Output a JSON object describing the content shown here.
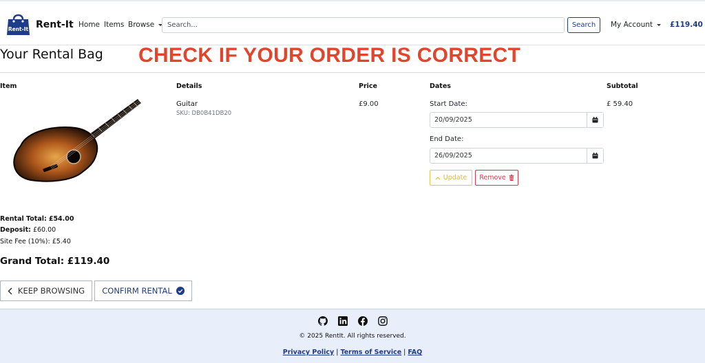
{
  "navbar": {
    "brand_name": "Rent-It",
    "logo_text": "Rent-It",
    "links": [
      "Home",
      "Items",
      "Browse"
    ],
    "search_placeholder": "Search...",
    "search_button": "Search",
    "account": "My Account",
    "cart_total": "£119.40"
  },
  "page": {
    "title": "Your Rental Bag",
    "annotation": "CHECK IF YOUR ORDER IS CORRECT"
  },
  "table": {
    "headers": [
      "Item",
      "Details",
      "Price",
      "Dates",
      "Subtotal"
    ],
    "item": {
      "name": "Guitar",
      "sku": "SKU: DB0B41DB20",
      "price": "£9.00",
      "subtotal": "£ 59.40",
      "start_label": "Start Date:",
      "start_date": "20/09/2025",
      "end_label": "End Date:",
      "end_date": "26/09/2025",
      "update_button": "Update",
      "remove_button": "Remove"
    }
  },
  "totals": {
    "rental_total_label": "Rental Total:",
    "rental_total": "£54.00",
    "deposit_label": "Deposit:",
    "deposit": "£60.00",
    "site_fee_label": "Site Fee (10%):",
    "site_fee": "£5.40",
    "grand_total": "Grand Total: £119.40"
  },
  "actions": {
    "keep_browsing": "KEEP BROWSING",
    "confirm_rental": "CONFIRM RENTAL"
  },
  "footer": {
    "social_icons": [
      "github-icon",
      "linkedin-icon",
      "facebook-icon",
      "instagram-icon"
    ],
    "copyright": "© 2025 RentIt. All rights reserved.",
    "links": [
      "Privacy Policy",
      "Terms of Service",
      "FAQ"
    ]
  },
  "colors": {
    "brand": "#1f3c88",
    "annotation": "#e2452b",
    "footer_bg": "#e8eefa",
    "danger": "#dc3545",
    "warning": "#e6b43a"
  }
}
